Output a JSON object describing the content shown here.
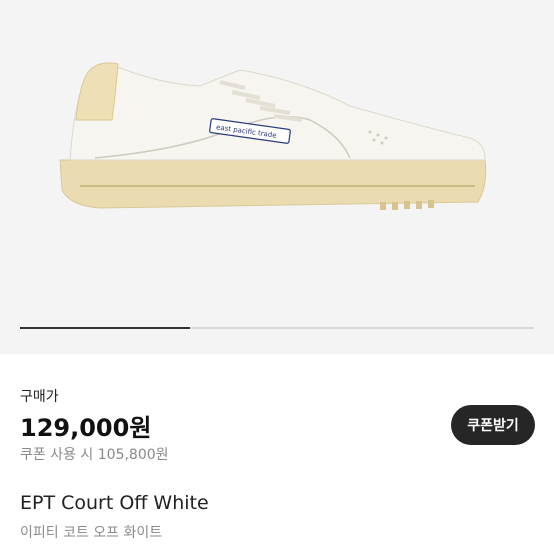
{
  "product": {
    "image_alt": "EPT Court Off White sneaker",
    "brand_tag": "east pacific trade",
    "carousel_progress": 0.33
  },
  "price_section": {
    "label": "구매가",
    "price": "129,000원",
    "coupon_text": "쿠폰 사용 시 105,800원",
    "coupon_button": "쿠폰받기"
  },
  "title": {
    "en": "EPT Court Off White",
    "ko": "이피티 코트 오프 화이트"
  },
  "colors": {
    "sole": "#eadbb0",
    "upper": "#f7f5ef",
    "heel_tab": "#efdfb4",
    "button_bg": "#262626"
  }
}
